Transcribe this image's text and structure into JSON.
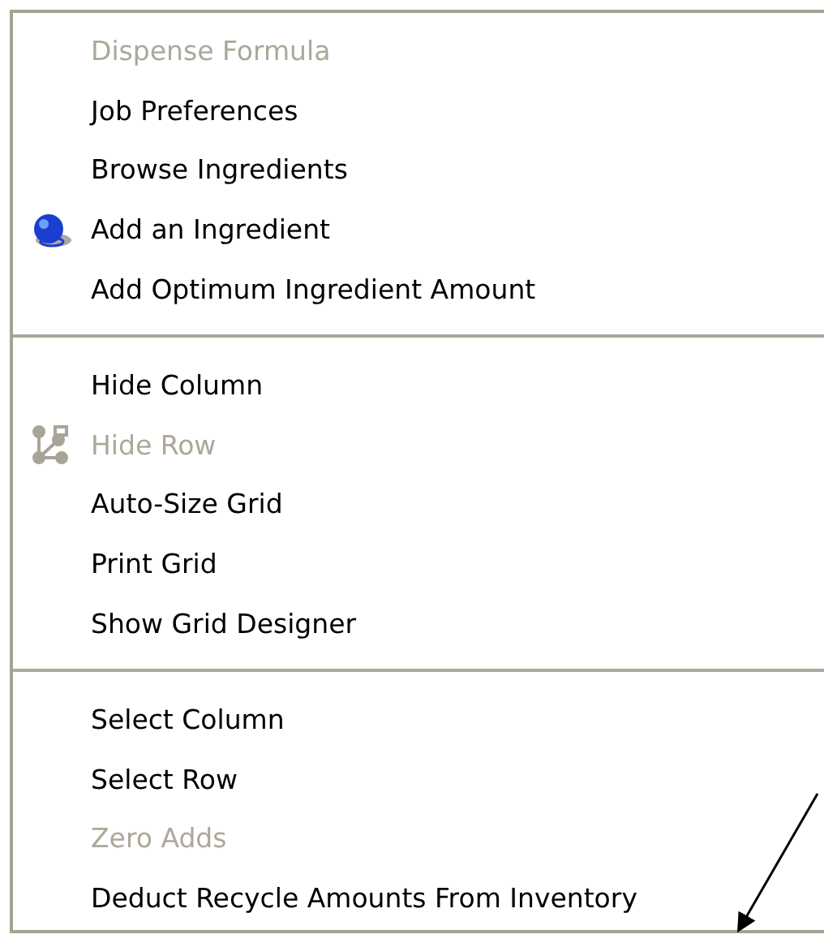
{
  "menu": {
    "groups": [
      {
        "items": [
          {
            "label": "Dispense Formula",
            "disabled": true,
            "kind": "text"
          },
          {
            "label": "Job Preferences",
            "disabled": false,
            "kind": "text"
          },
          {
            "label": "Browse Ingredients",
            "disabled": false,
            "kind": "text"
          },
          {
            "label": "Add an Ingredient",
            "disabled": false,
            "kind": "globe"
          },
          {
            "label": "Add Optimum Ingredient Amount",
            "disabled": false,
            "kind": "text"
          }
        ]
      },
      {
        "items": [
          {
            "label": "Hide Column",
            "disabled": false,
            "kind": "text"
          },
          {
            "label": "Hide Row",
            "disabled": true,
            "kind": "tree"
          },
          {
            "label": "Auto-Size Grid",
            "disabled": false,
            "kind": "text"
          },
          {
            "label": "Print Grid",
            "disabled": false,
            "kind": "text"
          },
          {
            "label": "Show Grid Designer",
            "disabled": false,
            "kind": "text"
          }
        ]
      },
      {
        "items": [
          {
            "label": "Select Column",
            "disabled": false,
            "kind": "text"
          },
          {
            "label": "Select Row",
            "disabled": false,
            "kind": "text"
          },
          {
            "label": "Zero Adds",
            "disabled": true,
            "kind": "text"
          },
          {
            "label": "Deduct Recycle Amounts From Inventory",
            "disabled": false,
            "kind": "text"
          }
        ]
      }
    ]
  }
}
